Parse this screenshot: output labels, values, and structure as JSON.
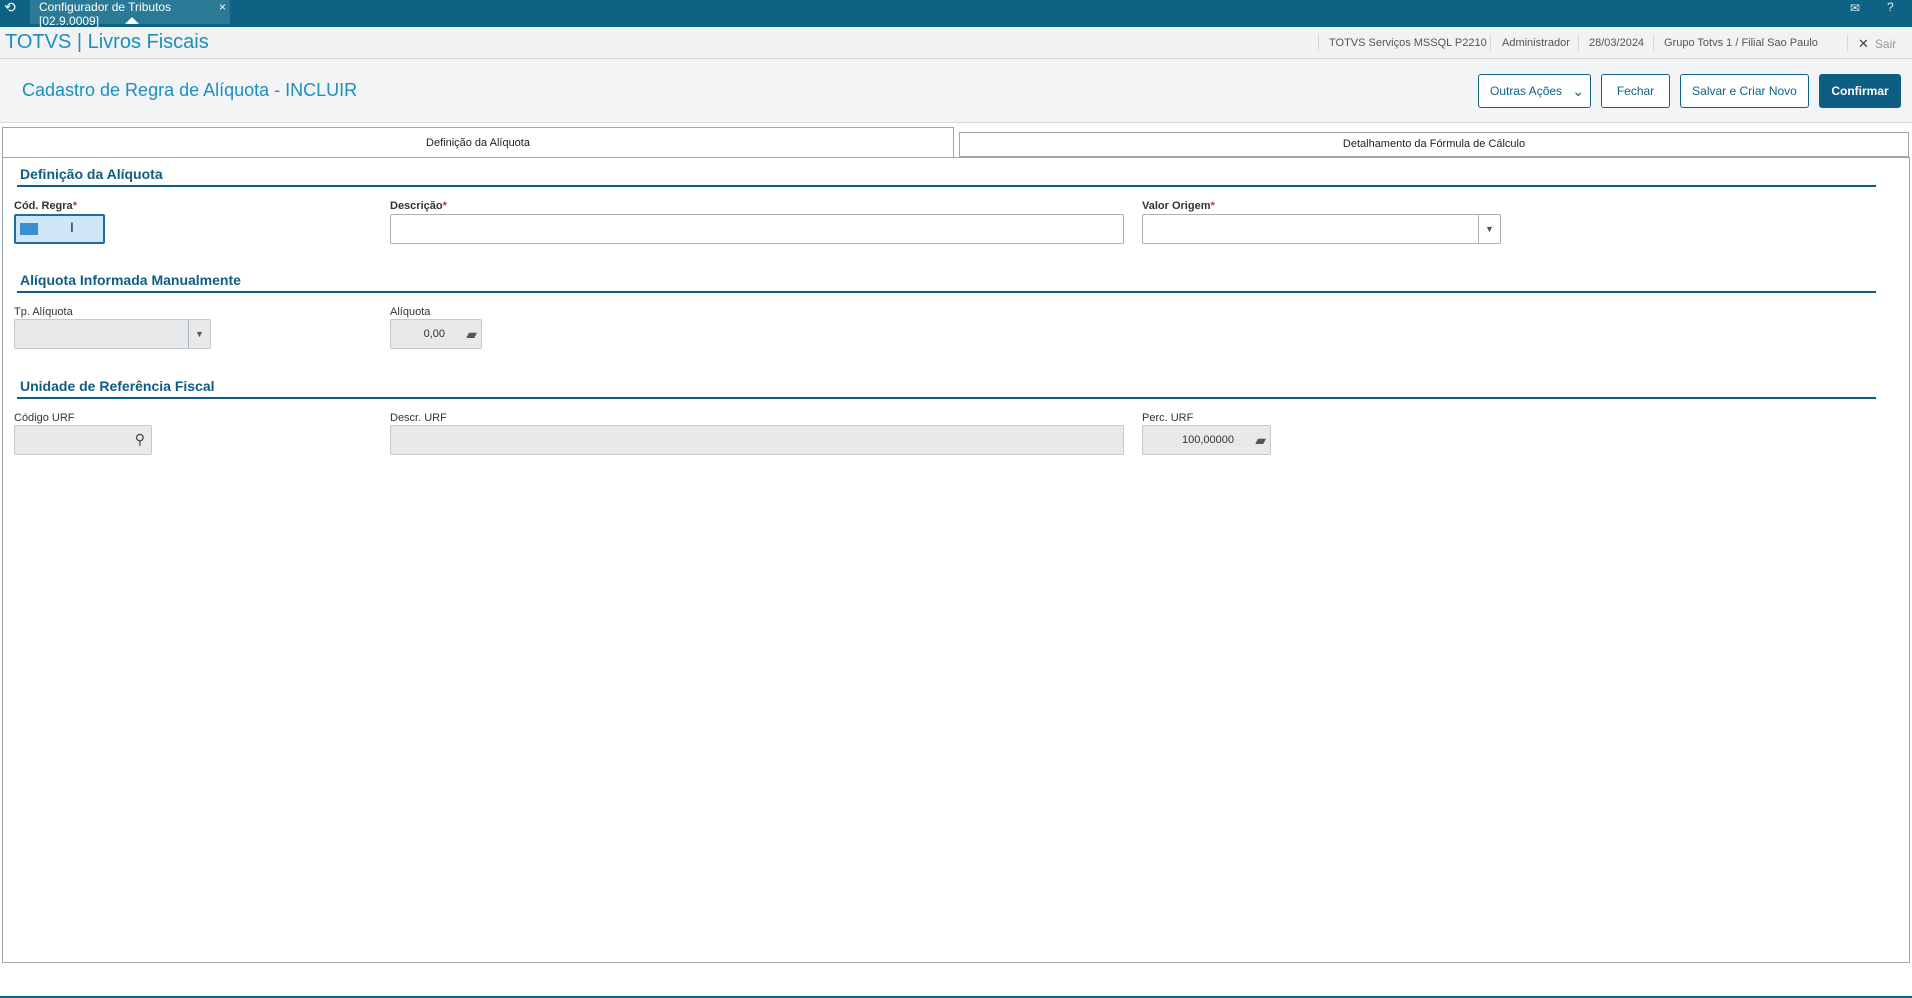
{
  "topbar": {
    "tab_label": "Configurador de Tributos [02.9.0009]",
    "close_glyph": "×",
    "icons": [
      "app-logo-icon",
      "mail-icon",
      "help-icon"
    ]
  },
  "header": {
    "brand": "TOTVS | Livros Fiscais",
    "environment": "TOTVS Serviços MSSQL P2210",
    "user": "Administrador",
    "date": "28/03/2024",
    "branch": "Grupo Totvs 1 / Filial Sao Paulo",
    "exit_label": "Sair"
  },
  "title_bar": {
    "title": "Cadastro de Regra de Alíquota - INCLUIR",
    "buttons": {
      "other_actions": "Outras Ações",
      "close": "Fechar",
      "save_new": "Salvar e Criar Novo",
      "confirm": "Confirmar"
    }
  },
  "tabs": [
    {
      "label": "Definição da Alíquota",
      "active": true
    },
    {
      "label": "Detalhamento da Fórmula de Cálculo",
      "active": false
    }
  ],
  "sections": {
    "definicao": {
      "title": "Definição da Alíquota",
      "cod_regra_label": "Cód. Regra",
      "descricao_label": "Descrição",
      "valor_origem_label": "Valor Origem",
      "required_mark": "*"
    },
    "manual": {
      "title": "Alíquota Informada Manualmente",
      "tp_aliquota_label": "Tp. Alíquota",
      "aliquota_label": "Alíquota",
      "aliquota_value": "0,00"
    },
    "urf": {
      "title": "Unidade de Referência Fiscal",
      "codigo_label": "Código URF",
      "descr_label": "Descr. URF",
      "perc_label": "Perc. URF",
      "perc_value": "100,00000"
    }
  },
  "colors": {
    "topbar": "#0e6384",
    "brand": "#1b8fc0",
    "primary_button": "#0e5d82",
    "section_title": "#0e5d82",
    "required": "#c0392b"
  }
}
